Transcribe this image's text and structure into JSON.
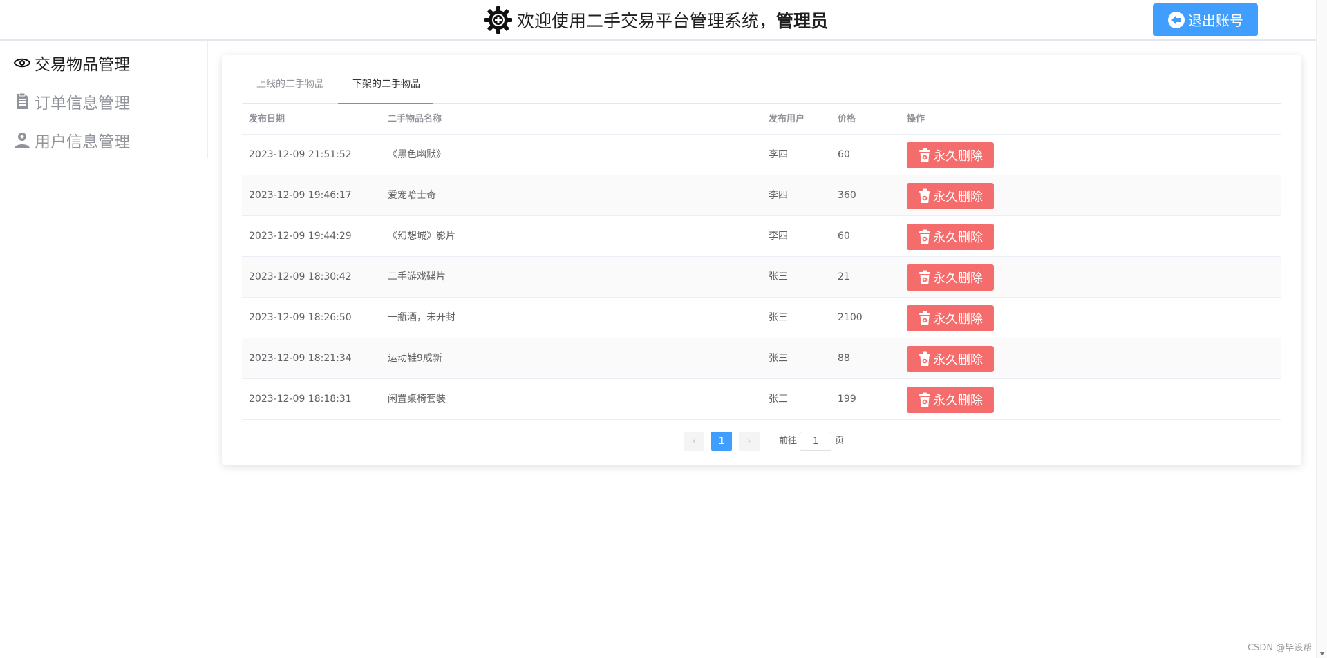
{
  "header": {
    "title_prefix": "欢迎使用二手交易平台管理系统，",
    "title_user": "管理员",
    "logout_label": "退出账号"
  },
  "sidebar": {
    "items": [
      {
        "label": "交易物品管理",
        "icon": "eye-icon",
        "active": true
      },
      {
        "label": "订单信息管理",
        "icon": "document-icon",
        "active": false
      },
      {
        "label": "用户信息管理",
        "icon": "user-icon",
        "active": false
      }
    ]
  },
  "tabs": [
    {
      "label": "上线的二手物品",
      "active": false
    },
    {
      "label": "下架的二手物品",
      "active": true
    }
  ],
  "table": {
    "columns": [
      "发布日期",
      "二手物品名称",
      "发布用户",
      "价格",
      "操作"
    ],
    "delete_label": "永久删除",
    "rows": [
      {
        "date": "2023-12-09 21:51:52",
        "name": "《黑色幽默》",
        "user": "李四",
        "price": "60"
      },
      {
        "date": "2023-12-09 19:46:17",
        "name": "爱宠哈士奇",
        "user": "李四",
        "price": "360"
      },
      {
        "date": "2023-12-09 19:44:29",
        "name": "《幻想城》影片",
        "user": "李四",
        "price": "60"
      },
      {
        "date": "2023-12-09 18:30:42",
        "name": "二手游戏碟片",
        "user": "张三",
        "price": "21"
      },
      {
        "date": "2023-12-09 18:26:50",
        "name": "一瓶酒，未开封",
        "user": "张三",
        "price": "2100"
      },
      {
        "date": "2023-12-09 18:21:34",
        "name": "运动鞋9成新",
        "user": "张三",
        "price": "88"
      },
      {
        "date": "2023-12-09 18:18:31",
        "name": "闲置桌椅套装",
        "user": "张三",
        "price": "199"
      }
    ]
  },
  "pagination": {
    "prev": "‹",
    "next": "›",
    "current": "1",
    "goto_prefix": "前往",
    "goto_value": "1",
    "goto_suffix": "页"
  },
  "watermark": "CSDN @毕设帮",
  "colors": {
    "primary": "#409eff",
    "danger": "#f56c6c"
  }
}
